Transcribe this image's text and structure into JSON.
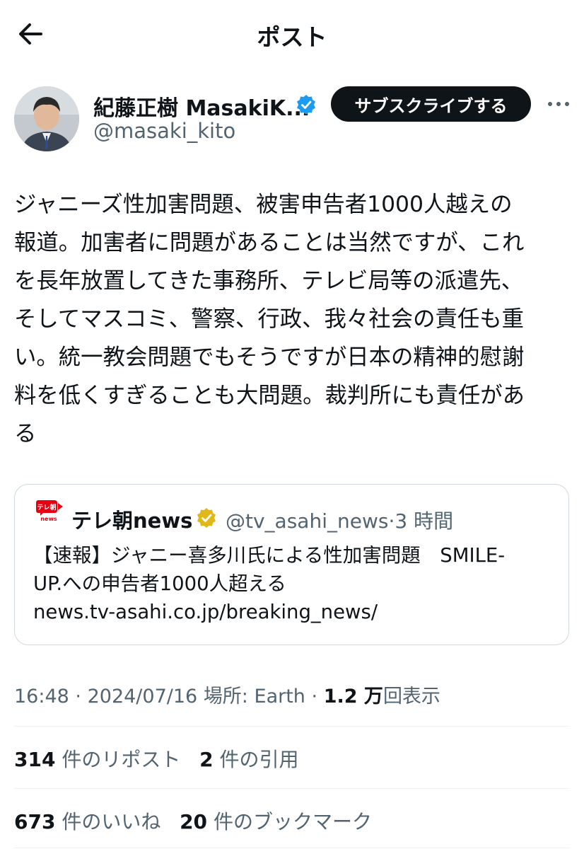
{
  "header": {
    "title": "ポスト"
  },
  "author": {
    "name": "紀藤正樹 MasakiK...",
    "handle": "@masaki_kito",
    "subscribe_label": "サブスクライブする"
  },
  "tweet": {
    "lines": [
      "ジャニーズ性加害問題、被害申告者1000人越えの",
      "報道。加害者に問題があることは当然ですが、これ",
      "を長年放置してきた事務所、テレビ局等の派遣先、",
      "そしてマスコミ、警察、行政、我々社会の責任も重",
      "い。統一教会問題でもそうですが日本の精神的慰謝",
      "料を低くすぎることも大問題。裁判所にも責任があ",
      "る"
    ]
  },
  "quote": {
    "logo_text": "テレ朝",
    "logo_sub": "news",
    "name": "テレ朝news",
    "handle": "@tv_asahi_news",
    "separator": "·",
    "time": "3 時間",
    "lines": [
      "【速報】ジャニー喜多川氏による性加害問題　SMILE-",
      "UP.への申告者1000人超える",
      "news.tv-asahi.co.jp/breaking_news/"
    ]
  },
  "meta": {
    "time": "16:48",
    "separator": "·",
    "date": "2024/07/16",
    "location_label": "場所:",
    "location": "Earth",
    "views": "1.2 万",
    "views_label": "回表示"
  },
  "stats": {
    "reposts": {
      "count": "314",
      "label": "件のリポスト"
    },
    "quotes": {
      "count": "2",
      "label": "件の引用"
    },
    "likes": {
      "count": "673",
      "label": "件のいいね"
    },
    "bookmarks": {
      "count": "20",
      "label": "件のブックマーク"
    }
  },
  "colors": {
    "primary_text": "#0f1419",
    "secondary_text": "#536471",
    "verified_blue": "#1d9bf0",
    "verified_gold": "#e2b719",
    "border": "#cfd9de",
    "brand_red": "#e60012"
  }
}
